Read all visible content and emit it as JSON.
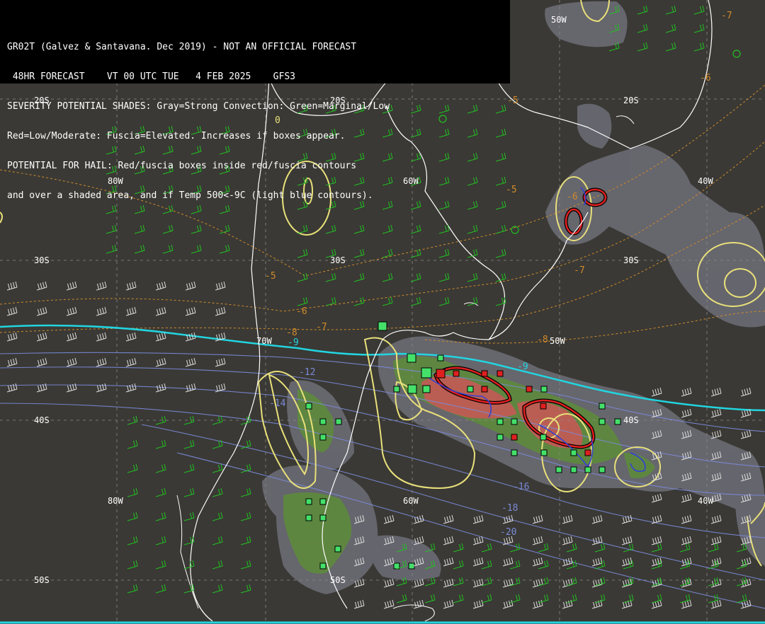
{
  "header": {
    "lines": [
      "GR02T (Galvez & Santavana. Dec 2019) - NOT AN OFFICIAL FORECAST",
      " 48HR FORECAST    VT 00 UTC TUE   4 FEB 2025    GFS3",
      "SEVERITY POTENTIAL SHADES: Gray=Strong Convection: Green=Marginal/Low",
      "Red=Low/Moderate: Fuscia=Elevated. Increases if boxes appear.",
      "POTENTIAL FOR HAIL: Red/fuscia boxes inside red/fuscia contours",
      "and over a shaded area, and if Temp 500<-9C (light blue contours)."
    ]
  },
  "grid_labels": [
    "50W",
    "20S",
    "20S",
    "20S",
    "80W",
    "60W",
    "40W",
    "30S",
    "30S",
    "30S",
    "70W",
    "50W",
    "40S",
    "40S",
    "80W",
    "60W",
    "40W",
    "50S",
    "50S"
  ],
  "temp_labels": {
    "orange": [
      "-7",
      "-5",
      "-6",
      "-5",
      "-6",
      "-8",
      "-8",
      "-7",
      "-6",
      "-7",
      "-5"
    ],
    "blue": [
      "-9",
      "-9",
      "-12",
      "-14",
      "-16",
      "-18",
      "-20"
    ],
    "yellow": [
      "0"
    ]
  },
  "colors": {
    "background": "#3a3935",
    "header_bg": "#000000",
    "coast": "#ffffff",
    "gray_shade": "#6a6a72",
    "green_shade": "#5a8a3a",
    "red_shade": "#c05050",
    "yellow_contour": "#e8e07a",
    "cyan_contour": "#22d5e0",
    "orange_contour": "#d08a2a",
    "blue_contour": "#3040d8",
    "wind_barb_white": "#dddddd",
    "wind_barb_green": "#22c022"
  }
}
